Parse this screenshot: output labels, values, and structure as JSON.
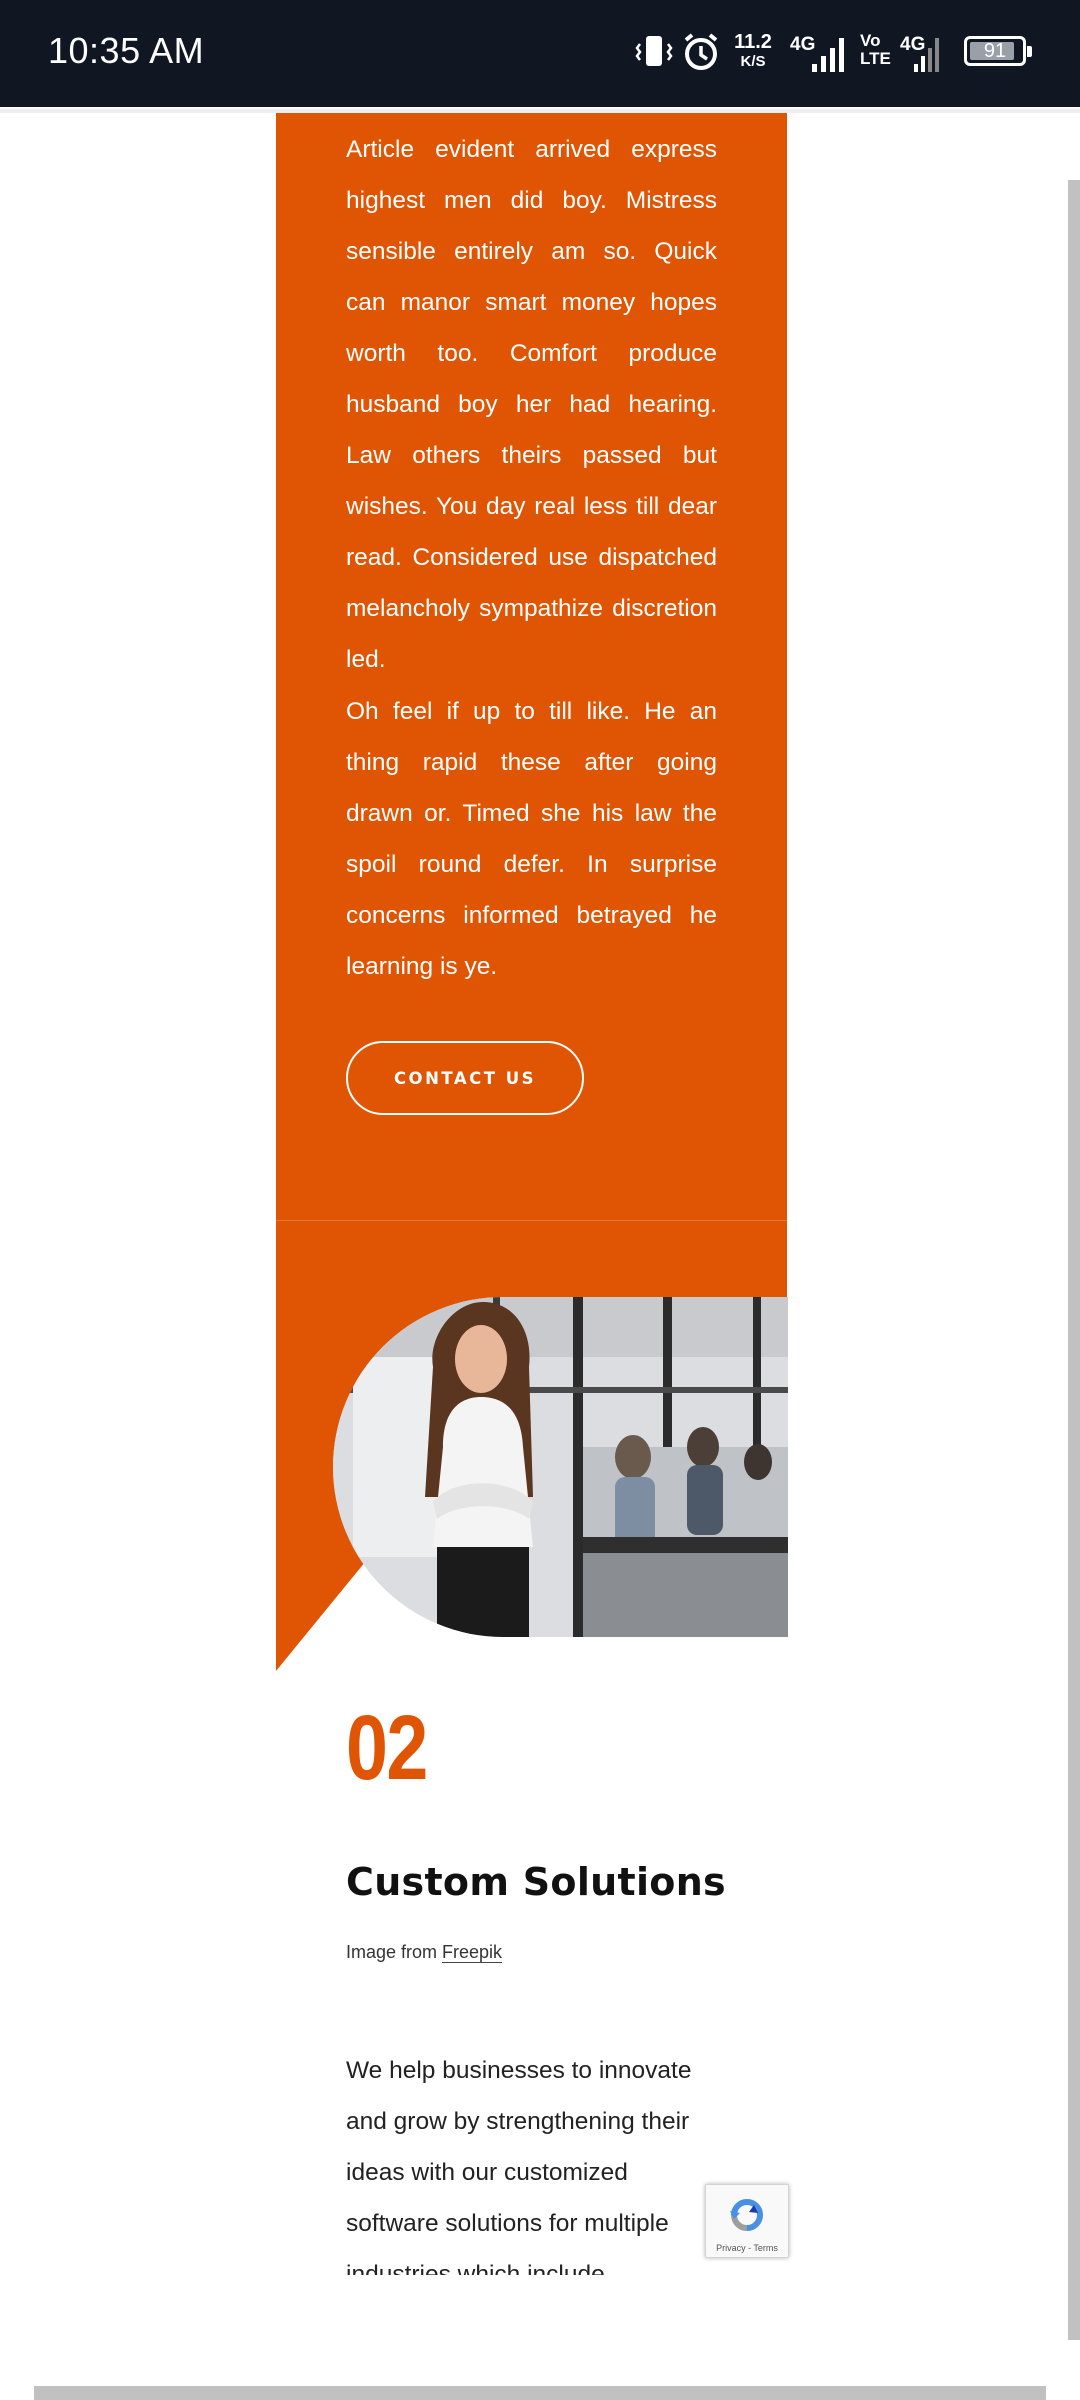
{
  "status_bar": {
    "time": "10:35 AM",
    "net_speed_value": "11.2",
    "net_speed_unit": "K/S",
    "network_1": "4G",
    "volte_line1": "Vo",
    "volte_line2": "LTE",
    "network_2": "4G",
    "battery": "91"
  },
  "orange_panel": {
    "paragraph_1": "Article evident arrived express highest men did boy. Mistress sensible entirely am so. Quick can manor smart money hopes worth too. Comfort produce husband boy her had hearing. Law others theirs passed but wishes. You day real less till dear read. Considered use dispatched melancholy sympathize discretion led.",
    "paragraph_2": "Oh feel if up to till like. He an thing rapid these after going drawn or. Timed she his law the spoil round defer. In surprise concerns informed betrayed he learning is ye.",
    "contact_button": "CONTACT US"
  },
  "section": {
    "number": "02",
    "title": "Custom Solutions",
    "credit_prefix": "Image from ",
    "credit_link": "Freepik",
    "body": "We help businesses to innovate and grow by strengthening their ideas with our customized software solutions for multiple industries which include"
  },
  "recaptcha": {
    "links": "Privacy - Terms"
  },
  "colors": {
    "accent": "#e05503",
    "status_bar": "#111722"
  }
}
